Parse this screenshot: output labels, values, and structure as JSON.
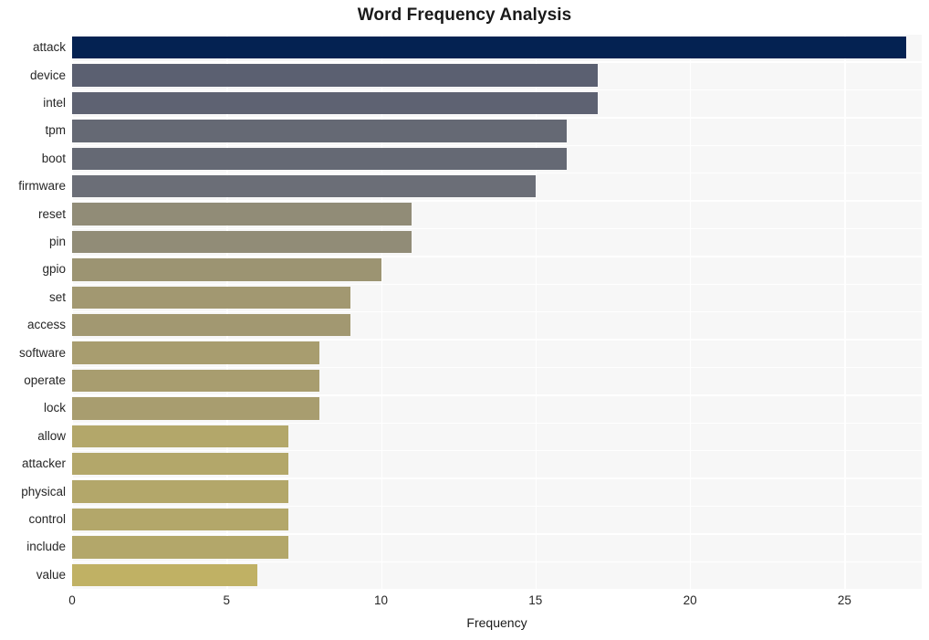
{
  "chart_data": {
    "type": "bar",
    "orientation": "horizontal",
    "title": "Word Frequency Analysis",
    "xlabel": "Frequency",
    "ylabel": "",
    "categories": [
      "attack",
      "device",
      "intel",
      "tpm",
      "boot",
      "firmware",
      "reset",
      "pin",
      "gpio",
      "set",
      "access",
      "software",
      "operate",
      "lock",
      "allow",
      "attacker",
      "physical",
      "control",
      "include",
      "value"
    ],
    "values": [
      27,
      17,
      17,
      16,
      16,
      15,
      11,
      11,
      10,
      9,
      9,
      8,
      8,
      8,
      7,
      7,
      7,
      7,
      7,
      6
    ],
    "xlim": [
      0,
      27.5
    ],
    "xticks": [
      0,
      5,
      10,
      15,
      20,
      25
    ],
    "xtick_labels": [
      "0",
      "5",
      "10",
      "15",
      "20",
      "25"
    ],
    "grid": true,
    "grid_color": "#ffffff",
    "legend": false,
    "plot_background": "#f7f7f7",
    "figure_background": "#ffffff",
    "bar_colors": [
      "#042252",
      "#5b6071",
      "#5e6272",
      "#656974",
      "#656974",
      "#6b6e77",
      "#918c77",
      "#918c77",
      "#9c9472",
      "#a29871",
      "#a29871",
      "#a89d6f",
      "#a89d6f",
      "#a89d6f",
      "#b3a76a",
      "#b3a76a",
      "#b3a76a",
      "#b3a76a",
      "#b3a76a",
      "#c0b164"
    ]
  }
}
